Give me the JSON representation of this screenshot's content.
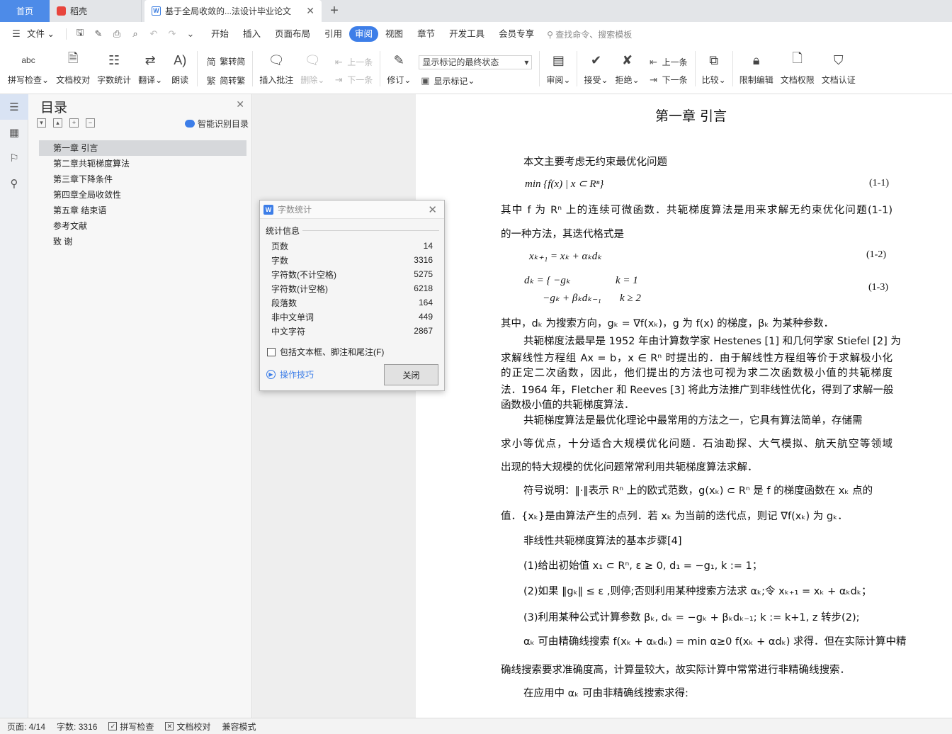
{
  "tabs": {
    "home": "首页",
    "doc1": "稻壳",
    "doc2": "基于全局收敛的...法设计毕业论文",
    "close": "✕",
    "add": "+"
  },
  "menubar": {
    "file": "文件",
    "items": [
      "开始",
      "插入",
      "页面布局",
      "引用",
      "审阅",
      "视图",
      "章节",
      "开发工具",
      "会员专享"
    ],
    "active": "审阅",
    "search": "查找命令、搜索模板"
  },
  "ribbon": {
    "spell": "拼写检查",
    "proof": "文档校对",
    "wordcount": "字数统计",
    "translate": "翻译",
    "read": "朗读",
    "trad_simp": "繁转简",
    "simp_trad": "简转繁",
    "insert_comment": "插入批注",
    "delete": "删除",
    "prev_comment": "上一条",
    "next_comment": "下一条",
    "track": "修订",
    "markup_select": "显示标记的最终状态",
    "show_markup": "显示标记",
    "review": "审阅",
    "accept": "接受",
    "reject": "拒绝",
    "prev_change": "上一条",
    "next_change": "下一条",
    "compare": "比较",
    "restrict": "限制编辑",
    "permission": "文档权限",
    "certify": "文档认证",
    "abc": "abc"
  },
  "toc": {
    "title": "目录",
    "smart": "智能识别目录",
    "items": [
      "第一章  引言",
      "第二章共轭梯度算法",
      "第三章下降条件",
      "第四章全局收敛性",
      "第五章  结束语",
      "参考文献",
      "致    谢"
    ]
  },
  "dialog": {
    "title": "字数统计",
    "section": "统计信息",
    "rows": [
      {
        "label": "页数",
        "value": "14"
      },
      {
        "label": "字数",
        "value": "3316"
      },
      {
        "label": "字符数(不计空格)",
        "value": "5275"
      },
      {
        "label": "字符数(计空格)",
        "value": "6218"
      },
      {
        "label": "段落数",
        "value": "164"
      },
      {
        "label": "非中文单词",
        "value": "449"
      },
      {
        "label": "中文字符",
        "value": "2867"
      }
    ],
    "include": "包括文本框、脚注和尾注(F)",
    "tips": "操作技巧",
    "close": "关闭"
  },
  "document": {
    "heading": "第一章  引言",
    "p1": "本文主要考虑无约束最优化问题",
    "eq1": "min {f(x) | x ⊂ Rⁿ}",
    "eq1_no": "(1-1)",
    "p2a": "其中 f 为 Rⁿ 上的连续可微函数．共轭梯度算法是用来求解无约束优化问题(1-1)",
    "p2b": "的一种方法，其迭代格式是",
    "eq2": "xₖ₊₁ = xₖ + αₖdₖ",
    "eq2_no": "(1-2)",
    "eq3a": "dₖ = { −gₖ                 k = 1",
    "eq3b": "       −gₖ + βₖdₖ₋₁       k ≥ 2",
    "eq3_no": "(1-3)",
    "p3": "其中，dₖ 为搜索方向，gₖ = ∇f(xₖ)，g 为 f(x) 的梯度，βₖ 为某种参数．",
    "p4a": "共轭梯度法最早是 1952 年由计算数学家  Hestenes [1] 和几何学家 Stiefel [2] 为",
    "p4b": "求解线性方程组 Ax = b，x ∈ Rⁿ 时提出的．由于解线性方程组等价于求解极小化",
    "p4c": "的正定二次函数，因此，他们提出的方法也可视为求二次函数极小值的共轭梯度",
    "p4d": "法．1964 年，Fletcher 和 Reeves [3] 将此方法推广到非线性优化，得到了求解一般",
    "p4e": "函数极小值的共轭梯度算法．",
    "p5a": "共轭梯度算法是最优化理论中最常用的方法之一，它具有算法简单，存储需",
    "p5b": "求小等优点，十分适合大规模优化问题．石油勘探、大气模拟、航天航空等领域",
    "p5c": "出现的特大规模的优化问题常常利用共轭梯度算法求解．",
    "p6a": "符号说明：‖·‖表示 Rⁿ 上的欧式范数，g(xₖ) ⊂ Rⁿ 是 f 的梯度函数在 xₖ 点的",
    "p6b": "值．{xₖ}是由算法产生的点列．若 xₖ 为当前的迭代点，则记 ∇f(xₖ) 为 gₖ．",
    "p7": "非线性共轭梯度算法的基本步骤[4]",
    "s1": "(1)给出初始值 x₁ ⊂ Rⁿ, ε ≥ 0, d₁ = −g₁, k := 1；",
    "s2": "(2)如果 ‖gₖ‖ ≤ ε ,则停;否则利用某种搜索方法求 αₖ;令 xₖ₊₁ = xₖ + αₖdₖ；",
    "s3": "(3)利用某种公式计算参数 βₖ, dₖ = −gₖ + βₖdₖ₋₁; k := k+1, z 转步(2);",
    "p8a": "αₖ 可由精确线搜索 f(xₖ + αₖdₖ) = min α≥0 f(xₖ + αdₖ) 求得．但在实际计算中精",
    "p8b": "确线搜索要求准确度高，计算量较大，故实际计算中常常进行非精确线搜索．",
    "p9": "在应用中 αₖ 可由非精确线搜索求得:"
  },
  "status": {
    "page": "页面: 4/14",
    "words": "字数: 3316",
    "spell": "拼写检查",
    "proof": "文档校对",
    "compat": "兼容模式"
  }
}
